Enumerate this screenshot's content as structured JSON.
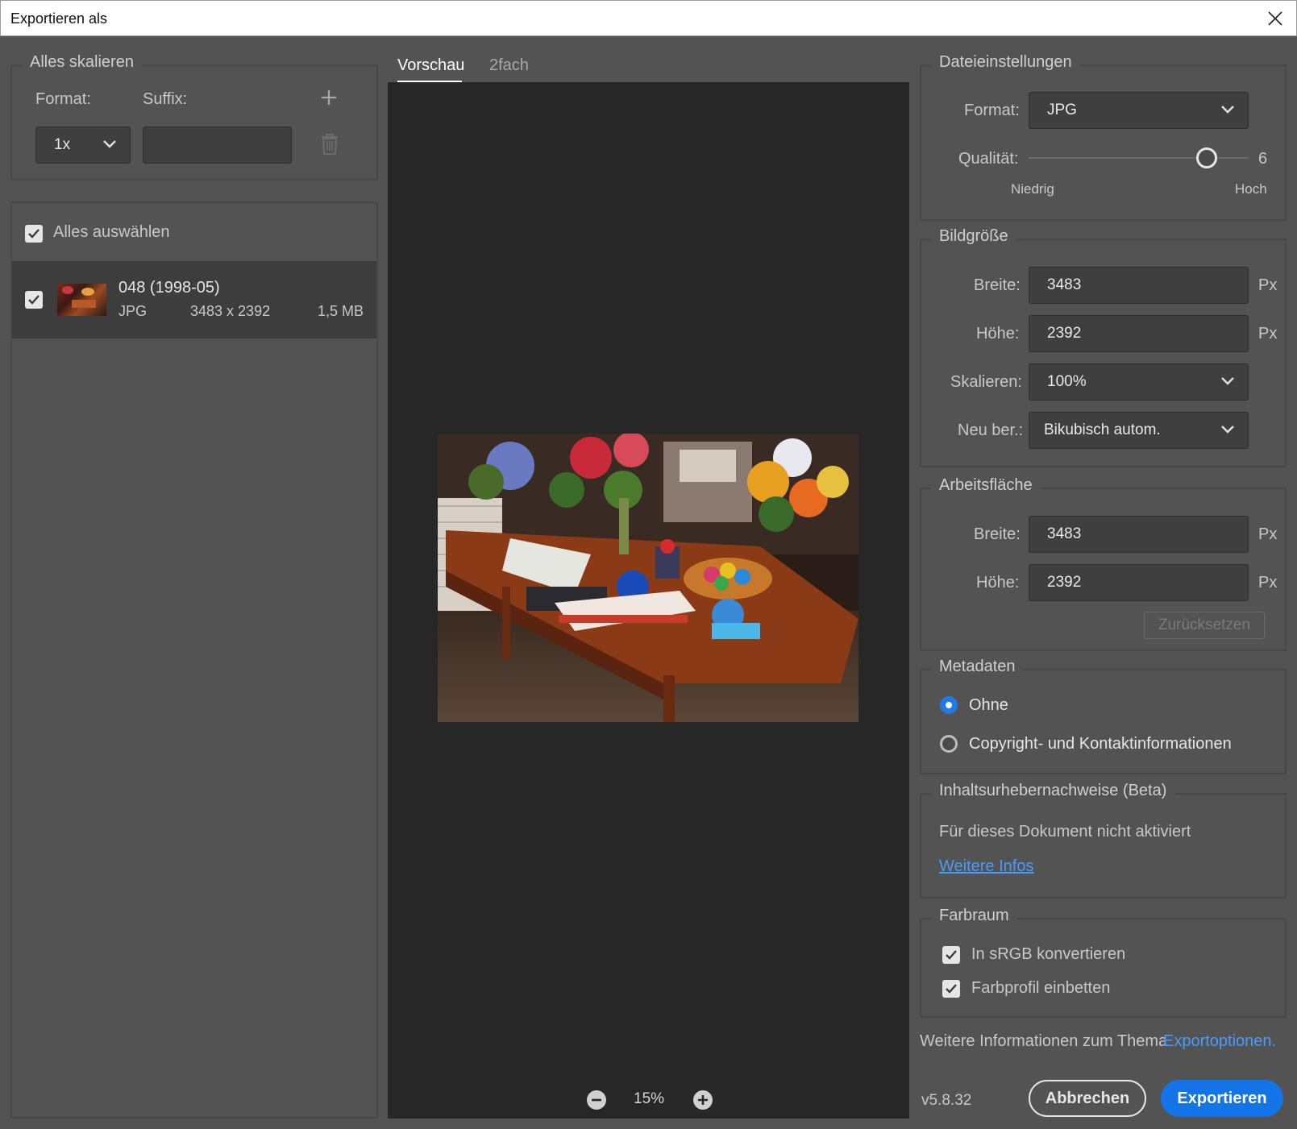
{
  "window": {
    "title": "Exportieren als"
  },
  "scale_all": {
    "legend": "Alles skalieren",
    "format_label": "Format:",
    "suffix_label": "Suffix:",
    "format_value": "1x",
    "suffix_value": ""
  },
  "assets": {
    "select_all_label": "Alles auswählen",
    "select_all_checked": true,
    "items": [
      {
        "name": "048 (1998-05)",
        "format": "JPG",
        "dimensions": "3483 x 2392",
        "size": "1,5 MB",
        "checked": true
      }
    ]
  },
  "preview": {
    "tabs": [
      {
        "label": "Vorschau",
        "active": true
      },
      {
        "label": "2fach",
        "active": false
      }
    ],
    "zoom": "15%"
  },
  "file_settings": {
    "legend": "Dateieinstellungen",
    "format_label": "Format:",
    "format_value": "JPG",
    "quality_label": "Qualität:",
    "quality_value": "6",
    "quality_low": "Niedrig",
    "quality_high": "Hoch"
  },
  "image_size": {
    "legend": "Bildgröße",
    "width_label": "Breite:",
    "width_value": "3483",
    "height_label": "Höhe:",
    "height_value": "2392",
    "scale_label": "Skalieren:",
    "scale_value": "100%",
    "resample_label": "Neu ber.:",
    "resample_value": "Bikubisch autom.",
    "unit": "Px"
  },
  "canvas": {
    "legend": "Arbeitsfläche",
    "width_label": "Breite:",
    "width_value": "3483",
    "height_label": "Höhe:",
    "height_value": "2392",
    "unit": "Px",
    "reset_label": "Zurücksetzen"
  },
  "metadata": {
    "legend": "Metadaten",
    "options": [
      {
        "label": "Ohne",
        "selected": true
      },
      {
        "label": "Copyright- und Kontaktinformationen",
        "selected": false
      }
    ]
  },
  "content_credentials": {
    "legend": "Inhaltsurhebernachweise (Beta)",
    "status": "Für dieses Dokument nicht aktiviert",
    "link": "Weitere Infos"
  },
  "color_space": {
    "legend": "Farbraum",
    "convert_srgb": "In sRGB konvertieren",
    "embed_profile": "Farbprofil einbetten"
  },
  "footer": {
    "info_text": "Weitere Informationen zum Thema",
    "info_link": "Exportoptionen.",
    "version": "v5.8.32",
    "cancel_label": "Abbrechen",
    "export_label": "Exportieren"
  },
  "colors": {
    "dialog_bg": "#535353",
    "preview_bg": "#272727",
    "accent": "#1473e6",
    "link": "#4a9bff"
  }
}
